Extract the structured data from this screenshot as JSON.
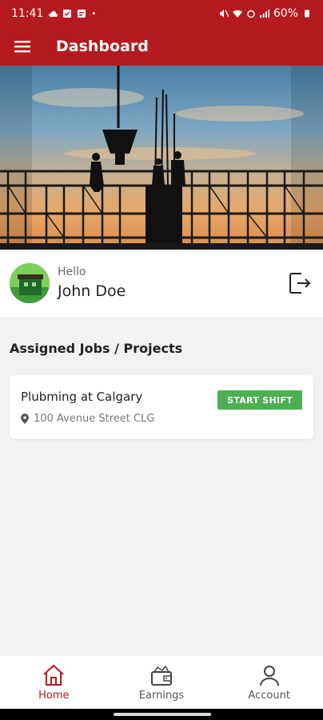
{
  "status_bar": {
    "time": "11:41",
    "battery": "60%"
  },
  "app_bar": {
    "title": "Dashboard"
  },
  "user": {
    "greeting": "Hello",
    "name": "John Doe"
  },
  "section": {
    "title": "Assigned Jobs /  Projects"
  },
  "jobs": [
    {
      "title": "Plubming at Calgary",
      "address": "100 Avenue Street CLG",
      "action_label": "START SHIFT"
    }
  ],
  "bottom_nav": [
    {
      "label": "Home",
      "icon": "home-icon",
      "active": true
    },
    {
      "label": "Earnings",
      "icon": "wallet-icon",
      "active": false
    },
    {
      "label": "Account",
      "icon": "user-icon",
      "active": false
    }
  ],
  "colors": {
    "primary": "#b51a1f",
    "accent_green": "#4caf50",
    "background": "#f2f2f2"
  }
}
